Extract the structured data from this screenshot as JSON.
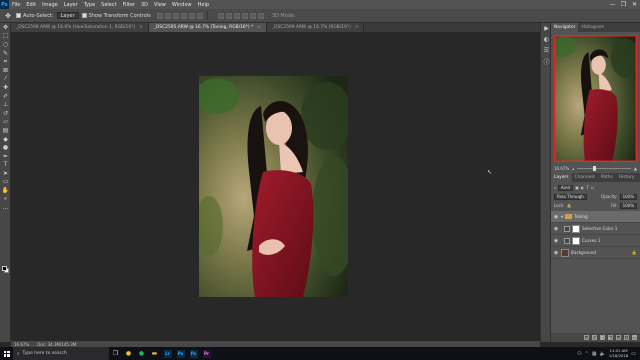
{
  "menubar": {
    "app_logo": "Ps",
    "items": [
      "File",
      "Edit",
      "Image",
      "Layer",
      "Type",
      "Select",
      "Filter",
      "3D",
      "View",
      "Window",
      "Help"
    ],
    "window_controls": [
      "—",
      "❐",
      "✕"
    ]
  },
  "options": {
    "auto_select_label": "Auto-Select:",
    "auto_select_value": "Layer",
    "transform_label": "Show Transform Controls",
    "mode_3d": "3D Mode:"
  },
  "tabs": [
    {
      "label": "_DSC2598.ARW @ 16.6% (Hue/Saturation 1, RGB/16*)",
      "close": "×"
    },
    {
      "label": "_DSC2595.ARW @ 16.7% (Toning, RGB/16*) *",
      "close": "×"
    },
    {
      "label": "_DSC2599.ARW @ 16.7% (RGB/16*)",
      "close": "×"
    }
  ],
  "status": {
    "zoom": "16.67%",
    "doc": "Doc: 34.3M/145.3M"
  },
  "navigator": {
    "tabs": [
      "Navigator",
      "Histogram"
    ],
    "zoom": "16.67%"
  },
  "layers_panel": {
    "tabs": [
      "Layers",
      "Channels",
      "Paths",
      "History"
    ],
    "filter_label": "Kind",
    "blend_mode": "Pass Through",
    "opacity_label": "Opacity:",
    "opacity_value": "100%",
    "lock_label": "Lock:",
    "fill_label": "Fill:",
    "fill_value": "100%",
    "layers": [
      {
        "name": "Toning",
        "type": "group"
      },
      {
        "name": "Selective Color 1",
        "type": "adjustment"
      },
      {
        "name": "Curves 1",
        "type": "adjustment"
      },
      {
        "name": "Background",
        "type": "image"
      }
    ]
  },
  "taskbar": {
    "search_placeholder": "Type here to search",
    "apps": [
      "Lr",
      "Ps",
      "Ps",
      "Pr"
    ],
    "time": "11:01 AM",
    "date": "1/18/2018"
  },
  "colors": {
    "accent": "#31a8ff",
    "dress": "#8a1522"
  }
}
